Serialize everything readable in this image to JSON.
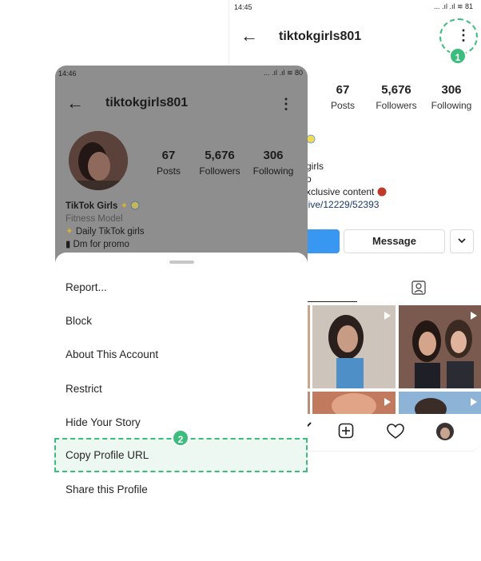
{
  "back_screen": {
    "status_time": "14:45",
    "status_icons": "... .ıl .ıl ≋ 81",
    "username": "tiktokgirls801",
    "stats": [
      {
        "value": "67",
        "label": "Posts"
      },
      {
        "value": "5,676",
        "label": "Followers"
      },
      {
        "value": "306",
        "label": "Following"
      }
    ],
    "bio_lines": [
      "girls",
      "o",
      "xclusive content",
      "live/12229/52393"
    ],
    "message_button": "Message",
    "step_badge": "1"
  },
  "front_screen": {
    "status_time": "14:46",
    "status_icons": "... .ıl .ıl ≋ 80",
    "username": "tiktokgirls801",
    "stats": [
      {
        "value": "67",
        "label": "Posts"
      },
      {
        "value": "5,676",
        "label": "Followers"
      },
      {
        "value": "306",
        "label": "Following"
      }
    ],
    "bio": {
      "name": "TikTok Girls",
      "role": "Fitness Model",
      "line1": "Daily TikTok girls",
      "line2": "Dm for promo"
    },
    "menu_items": [
      "Report...",
      "Block",
      "About This Account",
      "Restrict",
      "Hide Your Story"
    ],
    "highlighted_item": "Copy Profile URL",
    "last_item": "Share this Profile",
    "step_badge": "2"
  },
  "colors": {
    "accent_green": "#3dbd7d",
    "instagram_blue": "#3897f0",
    "overlay_gray": "#8e8e8e"
  }
}
